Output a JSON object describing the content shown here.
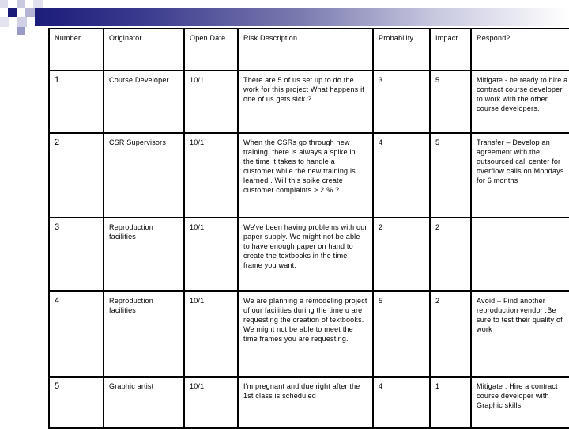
{
  "header": {
    "columns": [
      "Number",
      "Originator",
      "Open Date",
      "Risk Description",
      "Probability",
      "Impact",
      "Respond?"
    ]
  },
  "rows": [
    {
      "number": "1",
      "originator": "Course Developer",
      "open_date": "10/1",
      "description": "There are 5 of us set up to do the work for this project What happens if one of us gets sick ?",
      "probability": "3",
      "impact": "5",
      "respond": "Mitigate - be ready to hire a contract course developer to work with the other course developers."
    },
    {
      "number": "2",
      "originator": "CSR Supervisors",
      "open_date": "10/1",
      "description": "When the CSRs go through new training, there is always a spike in the time it takes to handle a customer while the new training is learned . Will this spike create customer complaints > 2 % ?",
      "probability": "4",
      "impact": "5",
      "respond": "Transfer – Develop an agreement with the outsourced call center for overflow calls on Mondays for 6 months"
    },
    {
      "number": "3",
      "originator": "Reproduction facilities",
      "open_date": "10/1",
      "description": "We've been having problems with our paper supply. We might not be able to have enough paper on hand to create the textbooks in the time frame you want.",
      "probability": "2",
      "impact": "2",
      "respond": ""
    },
    {
      "number": "4",
      "originator": "Reproduction facilities",
      "open_date": "10/1",
      "description": "We are planning a remodeling project of our facilities during the time u are requesting the creation of textbooks. We might not be able to meet the time frames you are requesting.",
      "probability": "5",
      "impact": "2",
      "respond": "Avoid – Find another reproduction vendor .Be sure to test their quality of work"
    },
    {
      "number": "5",
      "originator": "Graphic artist",
      "open_date": "10/1",
      "description": "I'm pregnant and due right after the 1st class is scheduled",
      "probability": "4",
      "impact": "1",
      "respond": "Mitigate : Hire a contract course developer with Graphic skills."
    }
  ]
}
